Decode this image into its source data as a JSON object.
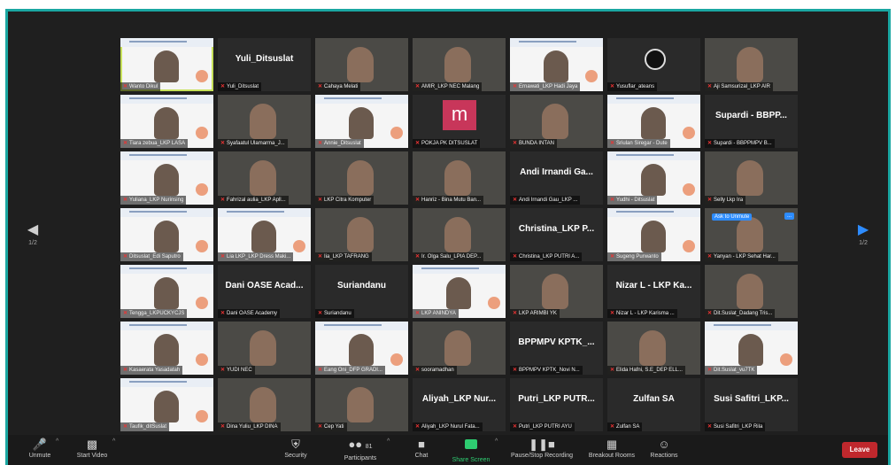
{
  "toolbar": {
    "unmute": "Unmute",
    "start_video": "Start Video",
    "security": "Security",
    "participants": "Participants",
    "participants_count": "81",
    "chat": "Chat",
    "share_screen": "Share Screen",
    "pause_recording": "Pause/Stop Recording",
    "breakout_rooms": "Breakout Rooms",
    "reactions": "Reactions",
    "leave": "Leave"
  },
  "pager": {
    "left": "1/2",
    "right": "1/2"
  },
  "tiles": [
    {
      "label": "Wanto Dikul",
      "kind": "slide",
      "active": true
    },
    {
      "label": "Yuli_Ditsuslat",
      "kind": "name",
      "big": "Yuli_Ditsuslat"
    },
    {
      "label": "Cahaya Melati",
      "kind": "cam"
    },
    {
      "label": "AMIR_LKP NEC Malang",
      "kind": "cam"
    },
    {
      "label": "Ernawati_LKP Hadi Jaya",
      "kind": "slide"
    },
    {
      "label": "Yusuflar_ateans",
      "kind": "hex"
    },
    {
      "label": "Aji Samsurizal_LKP AIR",
      "kind": "cam"
    },
    {
      "label": "Tiara zebua_LKP LASA",
      "kind": "slide"
    },
    {
      "label": "Syafaatul Ulamarma_J...",
      "kind": "cam"
    },
    {
      "label": "Annie_Ditsuslat",
      "kind": "slide"
    },
    {
      "label": "POKJA PK DITSUSLAT",
      "kind": "m"
    },
    {
      "label": "BUNDA INTAN",
      "kind": "cam"
    },
    {
      "label": "Sriulan Siregar - Dute",
      "kind": "slide"
    },
    {
      "label": "Supardi - BBPPMPV B...",
      "kind": "name",
      "big": "Supardi - BBPP..."
    },
    {
      "label": "Yuliana_LKP Nurinsing",
      "kind": "slide"
    },
    {
      "label": "Fahrizal aulia_LKP Apll...",
      "kind": "cam"
    },
    {
      "label": "LKP Citra Komputer",
      "kind": "cam"
    },
    {
      "label": "Hanriz - Bina Mutu Ban...",
      "kind": "cam"
    },
    {
      "label": "Andi Irnandi Gau_LKP ...",
      "kind": "name",
      "big": "Andi Irnandi Ga..."
    },
    {
      "label": "Yudhi - Ditsuslat",
      "kind": "slide"
    },
    {
      "label": "Selly Lkp Ira",
      "kind": "cam"
    },
    {
      "label": "Ditsuslat_Edi Saputro",
      "kind": "slide"
    },
    {
      "label": "Lia LKP_LKP Dress Maki...",
      "kind": "slide"
    },
    {
      "label": "Iia_LKP TAFRANG",
      "kind": "cam"
    },
    {
      "label": "Ir. Olga Salu_LPIA DEP...",
      "kind": "cam"
    },
    {
      "label": "Christina_LKP PUTRI A...",
      "kind": "name",
      "big": "Christina_LKP P..."
    },
    {
      "label": "Sugeng Purwanto",
      "kind": "slide"
    },
    {
      "label": "Yanyan - LKP Sehat Har...",
      "kind": "cam",
      "hand": "Ask to Unmute",
      "more": "..."
    },
    {
      "label": "Tengga_LKPUCKYCJS",
      "kind": "slide"
    },
    {
      "label": "Dani OASE Academy",
      "kind": "name",
      "big": "Dani OASE Acad..."
    },
    {
      "label": "Suriandanu",
      "kind": "name",
      "big": "Suriandanu"
    },
    {
      "label": "LKP ANINDYA",
      "kind": "slide"
    },
    {
      "label": "LKP ARIMBI YK",
      "kind": "cam"
    },
    {
      "label": "Nizar L - LKP Karisma ...",
      "kind": "name",
      "big": "Nizar L - LKP Ka..."
    },
    {
      "label": "Dit.Suslat_Dadang Tris...",
      "kind": "cam"
    },
    {
      "label": "Kasaerata Yasadatah",
      "kind": "slide"
    },
    {
      "label": "YUDI NEC",
      "kind": "cam"
    },
    {
      "label": "Eang Oni_DFP GRADI...",
      "kind": "slide"
    },
    {
      "label": "sooramadhan",
      "kind": "cam"
    },
    {
      "label": "BPPMPV KPTK_Novi N...",
      "kind": "name",
      "big": "BPPMPV KPTK_..."
    },
    {
      "label": "Elida Hafni, S.E_DEP ELL...",
      "kind": "cam"
    },
    {
      "label": "Dit.Suslat_vu7TK",
      "kind": "slide"
    },
    {
      "label": "Taufik_ditSuslat",
      "kind": "slide"
    },
    {
      "label": "Dina Yuliu_LKP DINA",
      "kind": "cam"
    },
    {
      "label": "Cep Yati",
      "kind": "cam"
    },
    {
      "label": "Aliyah_LKP Nurul Fata...",
      "kind": "name",
      "big": "Aliyah_LKP Nur..."
    },
    {
      "label": "Putri_LKP PUTRI AYU",
      "kind": "name",
      "big": "Putri_LKP PUTR..."
    },
    {
      "label": "Zulfan SA",
      "kind": "name",
      "big": "Zulfan SA"
    },
    {
      "label": "Susi Safitri_LKP Rila",
      "kind": "name",
      "big": "Susi Safitri_LKP..."
    }
  ]
}
